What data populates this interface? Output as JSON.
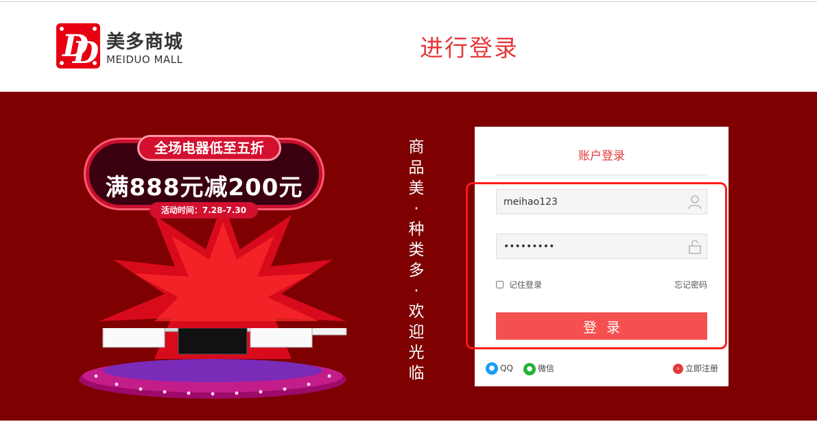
{
  "header": {
    "logo_cn": "美多商城",
    "logo_en": "MEIDUO MALL",
    "page_title": "进行登录"
  },
  "promo": {
    "headline": "全场电器低至五折",
    "offer": "满888元减200元",
    "date": "活动时间：7.28-7.30"
  },
  "slogan": [
    "商",
    "品",
    "美",
    "·",
    "种",
    "类",
    "多",
    "·",
    "欢",
    "迎",
    "光",
    "临"
  ],
  "login": {
    "title": "账户登录",
    "username_value": "meihao123",
    "password_value": "•••••••••",
    "remember_label": "记住登录",
    "forgot_label": "忘记密码",
    "login_button": "登录",
    "qq_label": "QQ",
    "wechat_label": "微信",
    "register_label": "立即注册"
  },
  "colors": {
    "brand_red": "#e60012",
    "banner_bg": "#7e0000",
    "title_red": "#e4393c",
    "button_red": "#f55050",
    "highlight_red": "#ff1a1a"
  }
}
